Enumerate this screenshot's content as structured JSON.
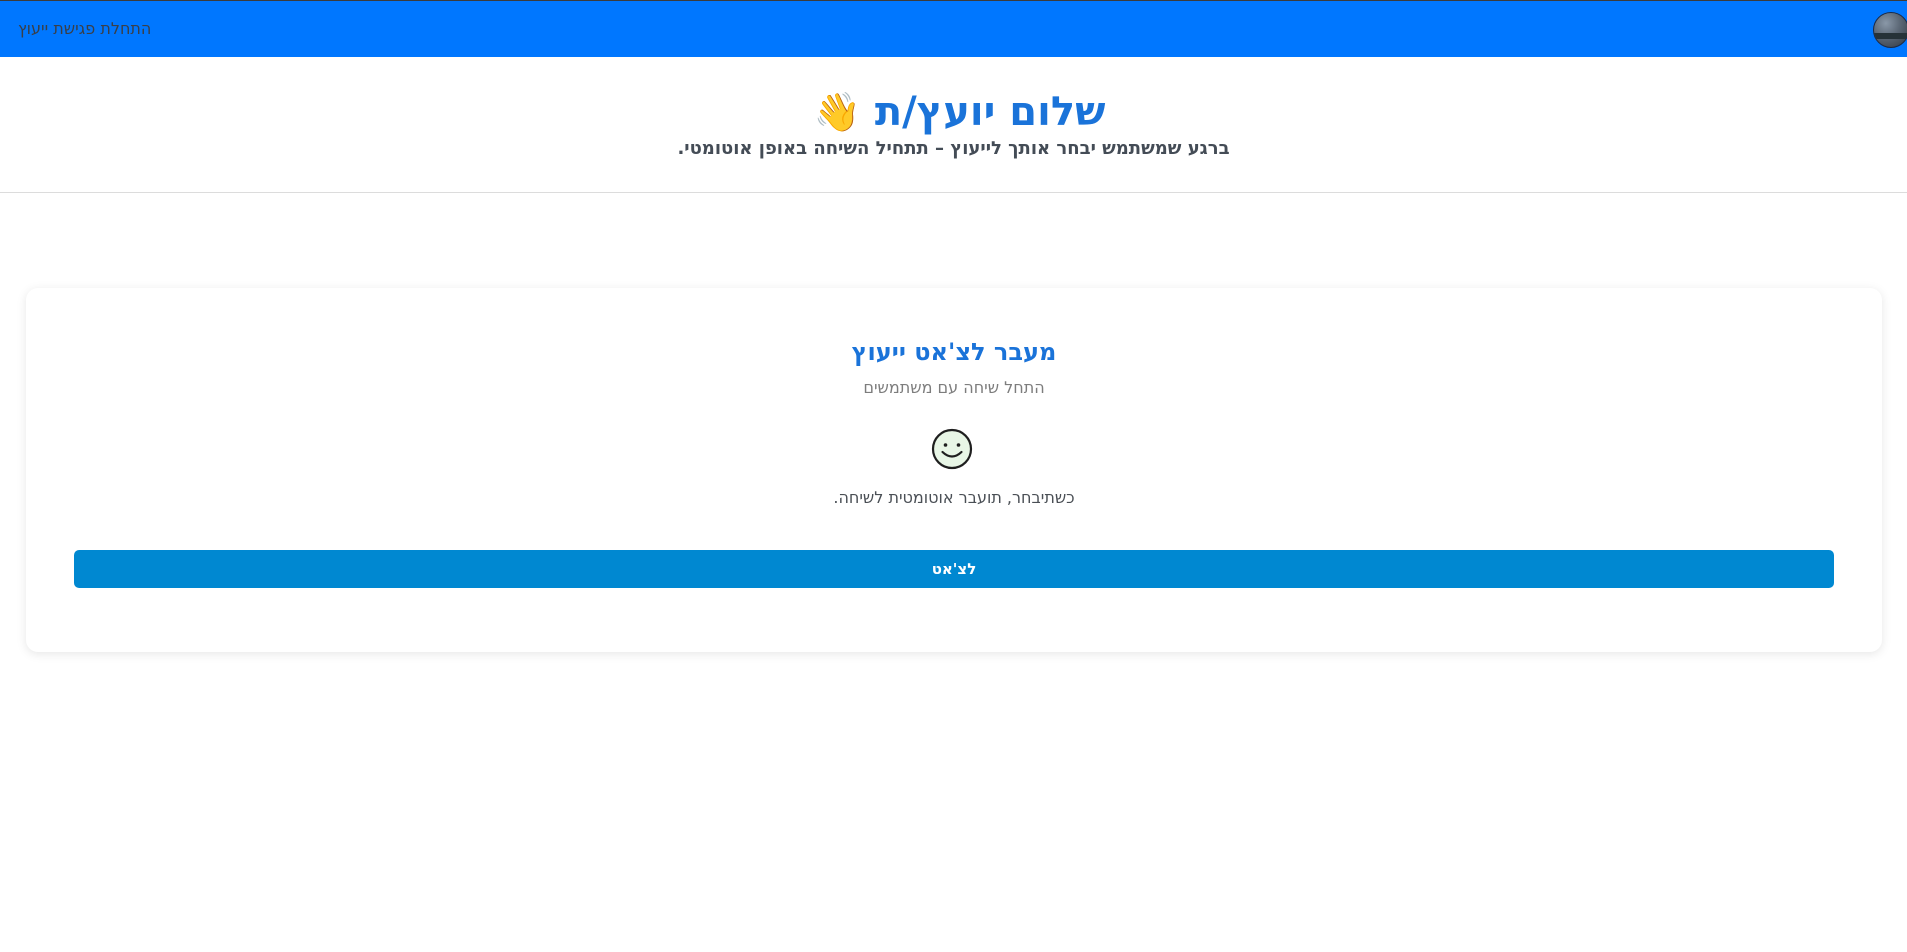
{
  "topbar": {
    "link_label": "התחלת פגישת ייעוץ",
    "background_color": "#0077ff"
  },
  "hero": {
    "title": "שלום יועץ/ת",
    "title_icon": "waving-hand-icon",
    "title_icon_glyph": "👋",
    "subtitle": "ברגע שמשתמש יבחר אותך לייעוץ – תתחיל השיחה באופן אוטומטי."
  },
  "card": {
    "title": "מעבר לצ'אט ייעוץ",
    "subtitle": "התחל שיחה עם משתמשים",
    "icon": "smiley-icon",
    "note": "כשתיבחר, תועבר אוטומטית לשיחה.",
    "button_label": "לצ'אט",
    "button_color": "#0088d1"
  }
}
